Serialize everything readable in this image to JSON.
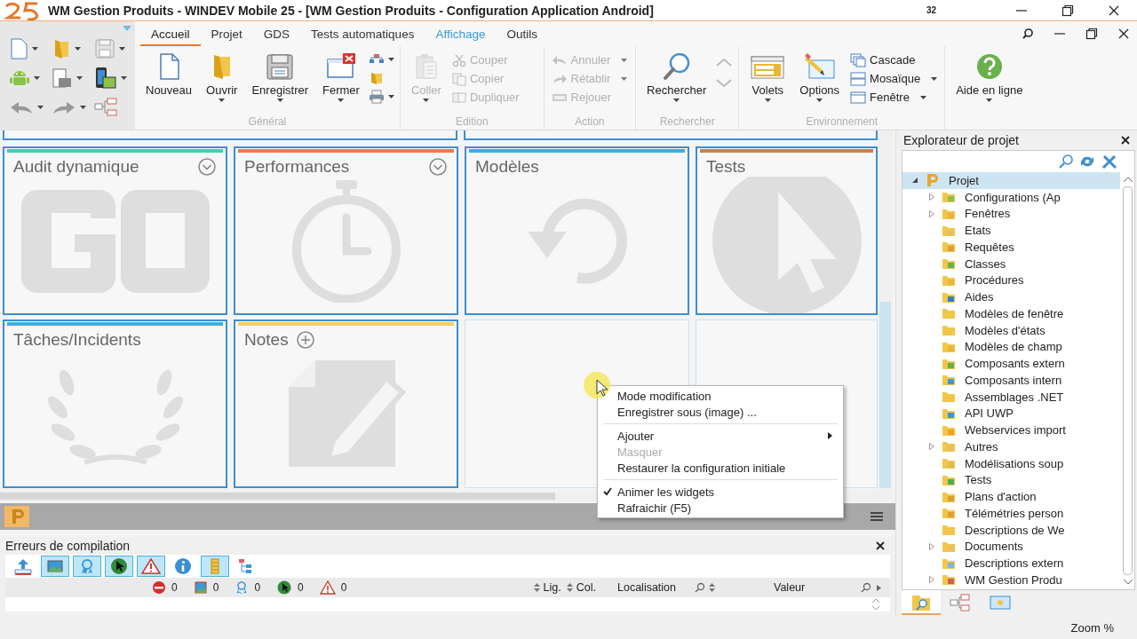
{
  "window": {
    "title": "WM Gestion Produits - WINDEV Mobile 25 - [WM Gestion Produits - Configuration Application Android]",
    "badge": "32"
  },
  "tabs": [
    {
      "label": "Accueil",
      "selected": true,
      "highlighted": false
    },
    {
      "label": "Projet",
      "selected": false,
      "highlighted": false
    },
    {
      "label": "GDS",
      "selected": false,
      "highlighted": false
    },
    {
      "label": "Tests automatiques",
      "selected": false,
      "highlighted": false
    },
    {
      "label": "Affichage",
      "selected": false,
      "highlighted": true
    },
    {
      "label": "Outils",
      "selected": false,
      "highlighted": false
    }
  ],
  "ribbon": {
    "groups": [
      {
        "label": "Général",
        "items": [
          {
            "kind": "large",
            "label": "Nouveau",
            "disabled": false,
            "dropdown": false
          },
          {
            "kind": "large",
            "label": "Ouvrir",
            "disabled": false,
            "dropdown": true
          },
          {
            "kind": "large",
            "label": "Enregistrer",
            "disabled": false,
            "dropdown": true
          },
          {
            "kind": "large",
            "label": "Fermer",
            "disabled": false,
            "dropdown": true
          },
          {
            "kind": "icons",
            "dropdown": true
          }
        ]
      },
      {
        "label": "Edition",
        "items": [
          {
            "kind": "large",
            "label": "Coller",
            "disabled": true,
            "dropdown": true
          },
          {
            "kind": "small",
            "label": "Couper",
            "disabled": true,
            "dropdown": false
          },
          {
            "kind": "small",
            "label": "Copier",
            "disabled": true,
            "dropdown": false
          },
          {
            "kind": "small",
            "label": "Dupliquer",
            "disabled": true,
            "dropdown": false
          }
        ]
      },
      {
        "label": "Action",
        "items": [
          {
            "kind": "small",
            "label": "Annuler",
            "disabled": true,
            "dropdown": true
          },
          {
            "kind": "small",
            "label": "Rétablir",
            "disabled": true,
            "dropdown": true
          },
          {
            "kind": "small",
            "label": "Rejouer",
            "disabled": true,
            "dropdown": false
          }
        ]
      },
      {
        "label": "Rechercher",
        "items": [
          {
            "kind": "large",
            "label": "Rechercher",
            "disabled": false,
            "dropdown": true
          },
          {
            "kind": "nav"
          }
        ]
      },
      {
        "label": "Environnement",
        "items": [
          {
            "kind": "large",
            "label": "Volets",
            "disabled": false,
            "dropdown": true
          },
          {
            "kind": "large",
            "label": "Options",
            "disabled": false,
            "dropdown": true
          },
          {
            "kind": "small",
            "label": "Cascade",
            "disabled": false,
            "dropdown": false
          },
          {
            "kind": "small",
            "label": "Mosaïque",
            "disabled": false,
            "dropdown": true
          },
          {
            "kind": "small",
            "label": "Fenêtre",
            "disabled": false,
            "dropdown": true
          }
        ]
      },
      {
        "items": [
          {
            "kind": "large",
            "label": "Aide en ligne",
            "disabled": false,
            "dropdown": true
          }
        ]
      }
    ]
  },
  "tiles": [
    {
      "kind": "widget",
      "title": "Audit dynamique",
      "color": "#3ed3a0",
      "collapse_button": true,
      "add_button": false
    },
    {
      "kind": "widget",
      "title": "Performances",
      "color": "#f07a4a",
      "collapse_button": true,
      "add_button": false
    },
    {
      "kind": "widget",
      "title": "Modèles",
      "color": "#3aafe0",
      "collapse_button": false,
      "add_button": false
    },
    {
      "kind": "widget",
      "title": "Tests",
      "color": "#c8824a",
      "collapse_button": false,
      "add_button": false
    },
    {
      "kind": "widget",
      "title": "Tâches/Incidents",
      "color": "#3aafe0",
      "collapse_button": false,
      "add_button": false
    },
    {
      "kind": "widget",
      "title": "Notes",
      "color": "#f5d060",
      "collapse_button": false,
      "add_button": true
    },
    {
      "kind": "empty"
    },
    {
      "kind": "empty"
    }
  ],
  "context_menu": [
    {
      "kind": "item",
      "label": "Mode modification",
      "checked": false,
      "disabled": false,
      "submenu": false
    },
    {
      "kind": "item",
      "label": "Enregistrer sous (image) ...",
      "checked": false,
      "disabled": false,
      "submenu": false
    },
    {
      "kind": "separator"
    },
    {
      "kind": "item",
      "label": "Ajouter",
      "checked": false,
      "disabled": false,
      "submenu": true
    },
    {
      "kind": "item",
      "label": "Masquer",
      "checked": false,
      "disabled": true,
      "submenu": false
    },
    {
      "kind": "item",
      "label": "Restaurer la configuration initiale",
      "checked": false,
      "disabled": false,
      "submenu": false
    },
    {
      "kind": "separator"
    },
    {
      "kind": "item",
      "label": "Animer les widgets",
      "checked": true,
      "disabled": false,
      "submenu": false
    },
    {
      "kind": "item",
      "label": "Rafraichir (F5)",
      "checked": false,
      "disabled": false,
      "submenu": false
    }
  ],
  "errors_panel": {
    "title": "Erreurs de compilation",
    "toolbar": [
      {
        "on": false
      },
      {
        "on": true
      },
      {
        "on": true
      },
      {
        "on": true
      },
      {
        "on": true
      },
      {
        "on": false
      },
      {
        "on": true
      },
      {
        "on": false
      }
    ],
    "counters": [
      "0",
      "0",
      "0",
      "0",
      "0"
    ],
    "columns": [
      "Lig.",
      "Col.",
      "Localisation",
      "Valeur"
    ]
  },
  "explorer": {
    "title": "Explorateur de projet",
    "root": {
      "label": "Projet",
      "expanded": true,
      "selected": true,
      "children": [
        {
          "label": "Configurations (Ap",
          "expandable": true,
          "selected": false
        },
        {
          "label": "Fenêtres",
          "expandable": true,
          "selected": false
        },
        {
          "label": "Etats",
          "expandable": false,
          "selected": false
        },
        {
          "label": "Requêtes",
          "expandable": false,
          "selected": false
        },
        {
          "label": "Classes",
          "expandable": false,
          "selected": false
        },
        {
          "label": "Procédures",
          "expandable": false,
          "selected": false
        },
        {
          "label": "Aides",
          "expandable": false,
          "selected": false
        },
        {
          "label": "Modèles de fenêtre",
          "expandable": false,
          "selected": false
        },
        {
          "label": "Modèles d'états",
          "expandable": false,
          "selected": false
        },
        {
          "label": "Modèles de champ",
          "expandable": false,
          "selected": false
        },
        {
          "label": "Composants extern",
          "expandable": false,
          "selected": false
        },
        {
          "label": "Composants intern",
          "expandable": false,
          "selected": false
        },
        {
          "label": "Assemblages .NET",
          "expandable": false,
          "selected": false
        },
        {
          "label": "API UWP",
          "expandable": false,
          "selected": false
        },
        {
          "label": "Webservices import",
          "expandable": false,
          "selected": false
        },
        {
          "label": "Autres",
          "expandable": true,
          "selected": false
        },
        {
          "label": "Modélisations soup",
          "expandable": false,
          "selected": false
        },
        {
          "label": "Tests",
          "expandable": false,
          "selected": false
        },
        {
          "label": "Plans d'action",
          "expandable": false,
          "selected": false
        },
        {
          "label": "Télémétries person",
          "expandable": false,
          "selected": false
        },
        {
          "label": "Descriptions de We",
          "expandable": false,
          "selected": false
        },
        {
          "label": "Documents",
          "expandable": true,
          "selected": false
        },
        {
          "label": "Descriptions extern",
          "expandable": false,
          "selected": false
        },
        {
          "label": "WM Gestion Produ",
          "expandable": true,
          "selected": false
        }
      ]
    },
    "tabs": [
      {
        "selected": true
      },
      {
        "selected": false
      },
      {
        "selected": false
      }
    ]
  },
  "status_bar": {
    "zoom": "Zoom %"
  }
}
